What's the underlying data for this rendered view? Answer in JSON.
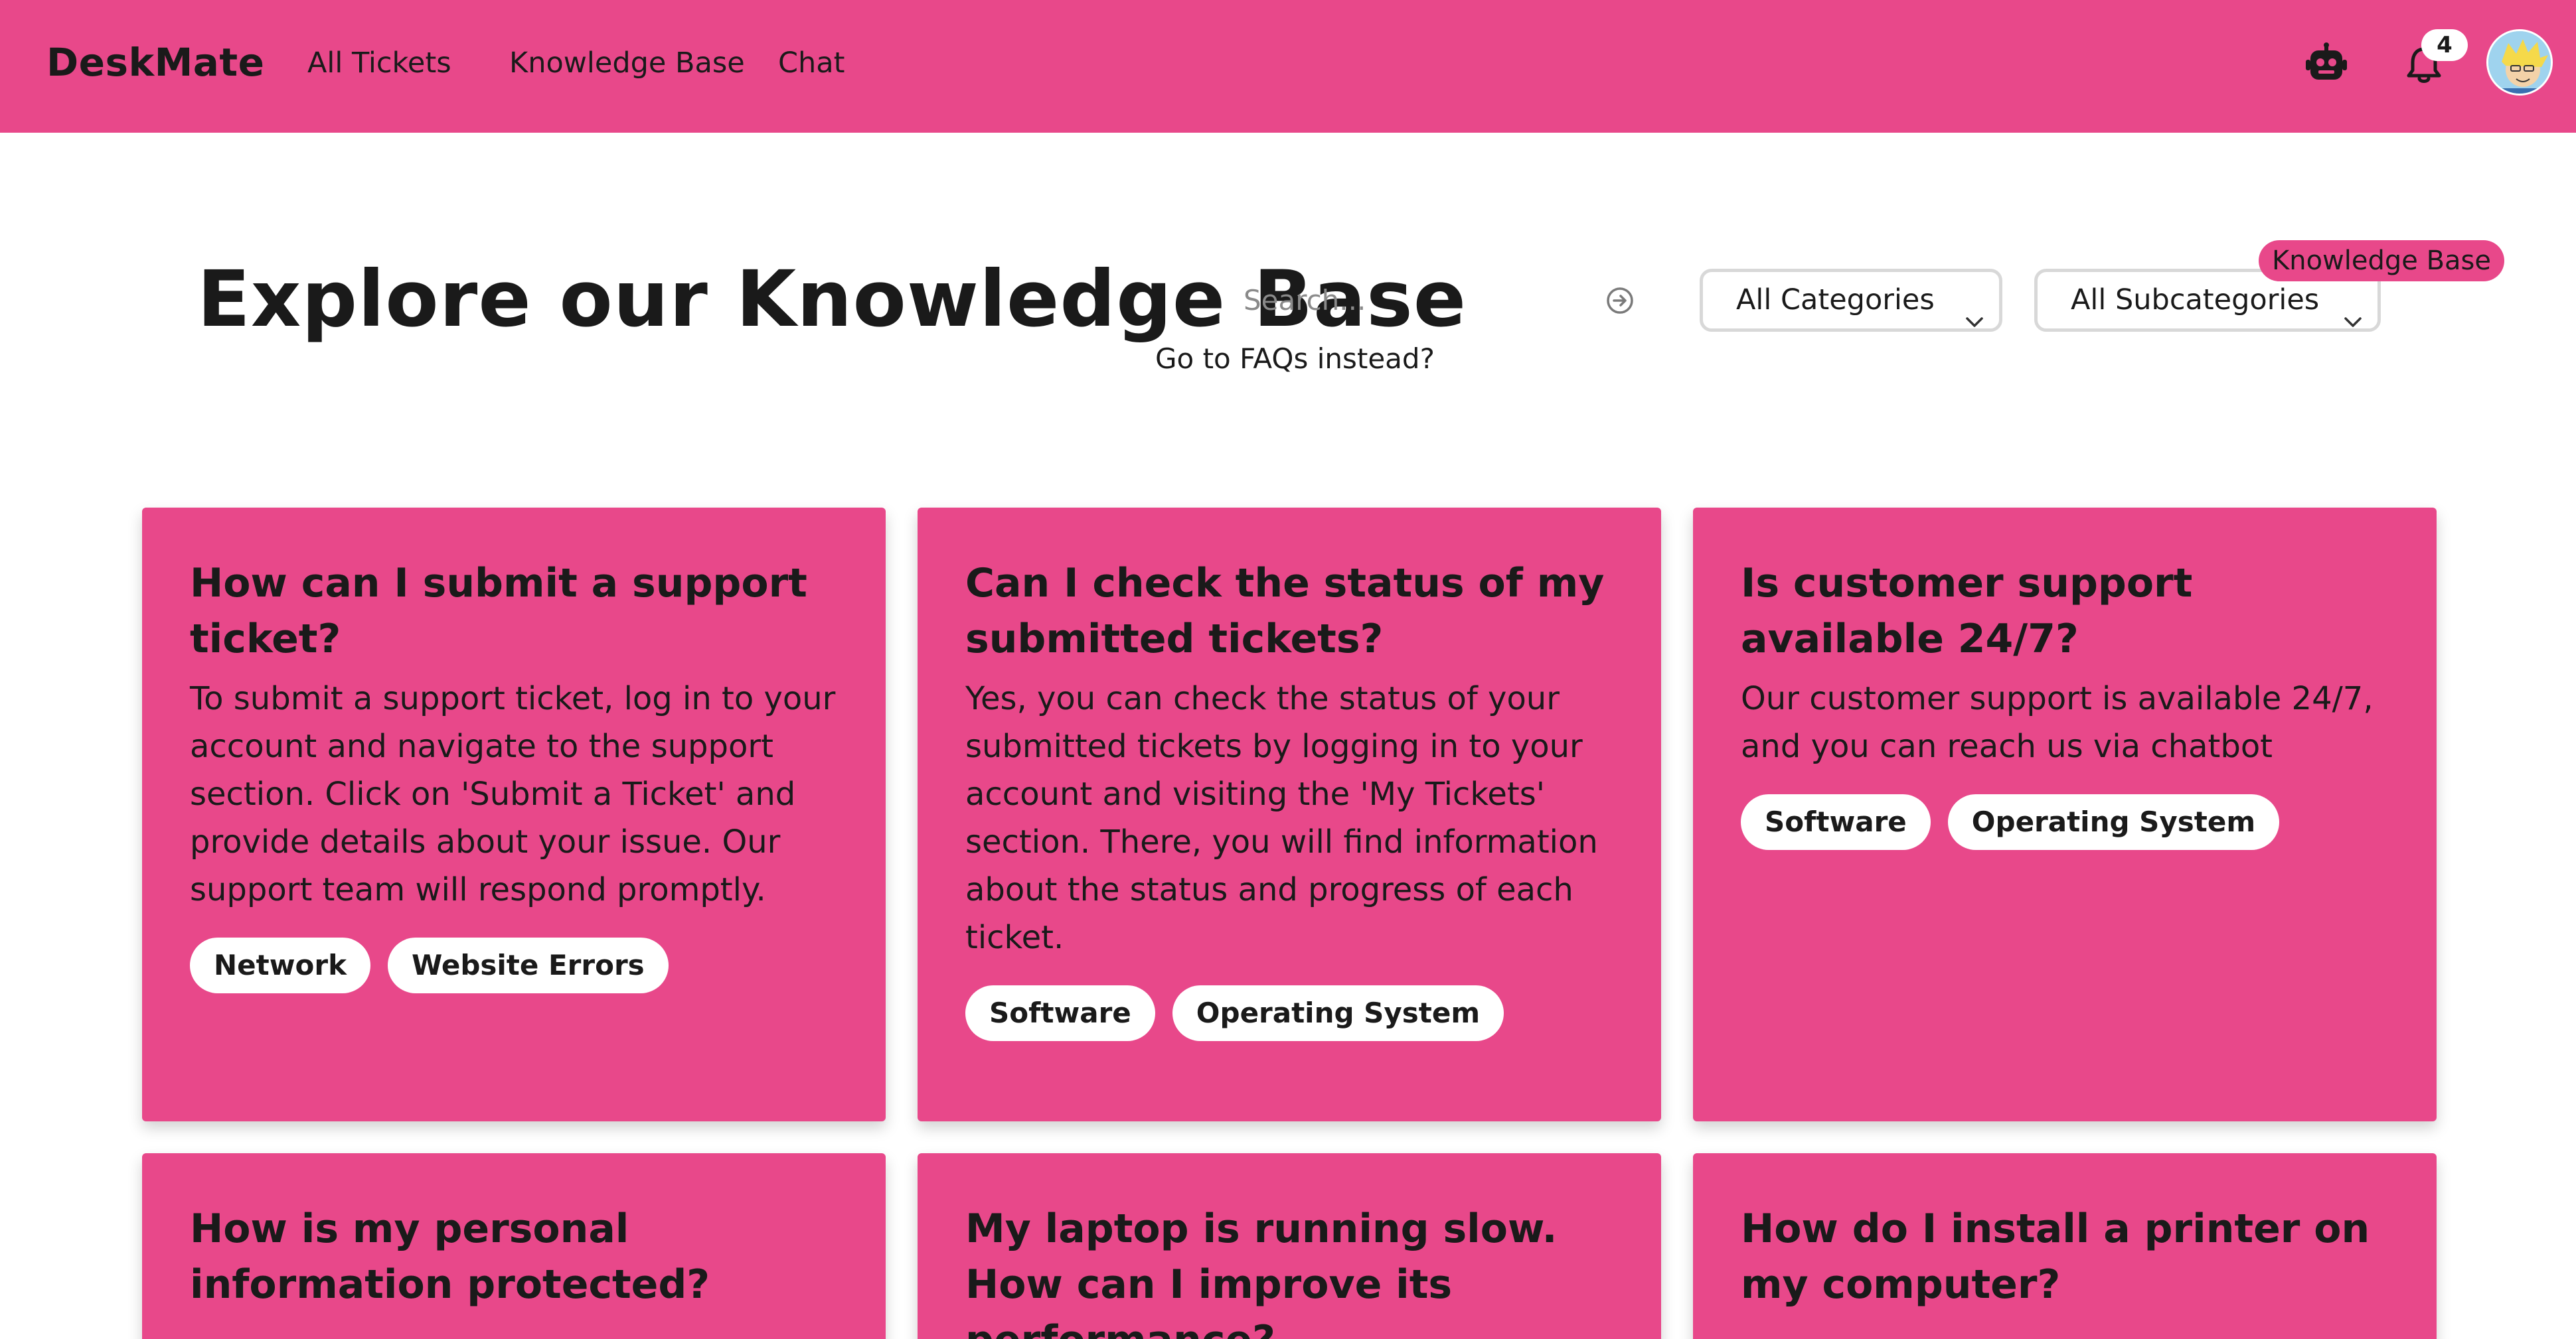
{
  "nav": {
    "brand": "DeskMate",
    "links": [
      "All Tickets",
      "Knowledge Base",
      "Chat"
    ],
    "notification_count": "4",
    "icons": [
      "robot-icon",
      "bell-icon",
      "avatar"
    ]
  },
  "header": {
    "title": "Explore our Knowledge Base",
    "search_placeholder": "Search...",
    "faq_link": "Go to FAQs instead?",
    "category_select": "All Categories",
    "subcategory_select": "All Subcategories",
    "tooltip": "Knowledge Base"
  },
  "articles": [
    {
      "title": "How can I submit a support ticket?",
      "body": "To submit a support ticket, log in to your account and navigate to the support section. Click on 'Submit a Ticket' and provide details about your issue. Our support team will respond promptly.",
      "tags": [
        "Network",
        "Website Errors"
      ]
    },
    {
      "title": "Can I check the status of my submitted tickets?",
      "body": "Yes, you can check the status of your submitted tickets by logging in to your account and visiting the 'My Tickets' section. There, you will find information about the status and progress of each ticket.",
      "tags": [
        "Software",
        "Operating System"
      ]
    },
    {
      "title": "Is customer support available 24/7?",
      "body": "Our customer support is available 24/7, and you can reach us via chatbot",
      "tags": [
        "Software",
        "Operating System"
      ]
    },
    {
      "title": "How is my personal information protected?",
      "body": "",
      "tags": []
    },
    {
      "title": "My laptop is running slow. How can I improve its performance?",
      "body": "",
      "tags": []
    },
    {
      "title": "How do I install a printer on my computer?",
      "body": "",
      "tags": []
    }
  ],
  "colors": {
    "brand_pink": "#e8488a",
    "tag_bg": "#ffffff",
    "text": "#1a1a1a"
  }
}
